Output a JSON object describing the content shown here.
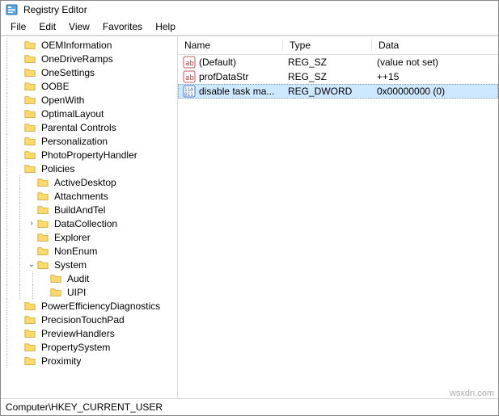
{
  "window": {
    "title": "Registry Editor"
  },
  "menu": [
    "File",
    "Edit",
    "View",
    "Favorites",
    "Help"
  ],
  "tree": [
    {
      "label": "OEMInformation",
      "depth": 1,
      "expander": ""
    },
    {
      "label": "OneDriveRamps",
      "depth": 1,
      "expander": ""
    },
    {
      "label": "OneSettings",
      "depth": 1,
      "expander": ""
    },
    {
      "label": "OOBE",
      "depth": 1,
      "expander": ""
    },
    {
      "label": "OpenWith",
      "depth": 1,
      "expander": ""
    },
    {
      "label": "OptimalLayout",
      "depth": 1,
      "expander": ""
    },
    {
      "label": "Parental Controls",
      "depth": 1,
      "expander": ""
    },
    {
      "label": "Personalization",
      "depth": 1,
      "expander": ""
    },
    {
      "label": "PhotoPropertyHandler",
      "depth": 1,
      "expander": ""
    },
    {
      "label": "Policies",
      "depth": 1,
      "expander": ""
    },
    {
      "label": "ActiveDesktop",
      "depth": 2,
      "expander": ""
    },
    {
      "label": "Attachments",
      "depth": 2,
      "expander": ""
    },
    {
      "label": "BuildAndTel",
      "depth": 2,
      "expander": ""
    },
    {
      "label": "DataCollection",
      "depth": 2,
      "expander": ">"
    },
    {
      "label": "Explorer",
      "depth": 2,
      "expander": ""
    },
    {
      "label": "NonEnum",
      "depth": 2,
      "expander": ""
    },
    {
      "label": "System",
      "depth": 2,
      "expander": "v"
    },
    {
      "label": "Audit",
      "depth": 3,
      "expander": ""
    },
    {
      "label": "UIPI",
      "depth": 3,
      "expander": ""
    },
    {
      "label": "PowerEfficiencyDiagnostics",
      "depth": 1,
      "expander": ""
    },
    {
      "label": "PrecisionTouchPad",
      "depth": 1,
      "expander": ""
    },
    {
      "label": "PreviewHandlers",
      "depth": 1,
      "expander": ""
    },
    {
      "label": "PropertySystem",
      "depth": 1,
      "expander": ""
    },
    {
      "label": "Proximity",
      "depth": 1,
      "expander": ""
    }
  ],
  "list": {
    "columns": {
      "name": "Name",
      "type": "Type",
      "data": "Data"
    },
    "rows": [
      {
        "icon": "string",
        "name": "(Default)",
        "type": "REG_SZ",
        "data": "(value not set)",
        "selected": false
      },
      {
        "icon": "string",
        "name": "profDataStr",
        "type": "REG_SZ",
        "data": "++15",
        "selected": false
      },
      {
        "icon": "dword",
        "name": "disable task ma...",
        "type": "REG_DWORD",
        "data": "0x00000000 (0)",
        "selected": true
      }
    ]
  },
  "status": "Computer\\HKEY_CURRENT_USER",
  "watermark": "wsxdn.com"
}
